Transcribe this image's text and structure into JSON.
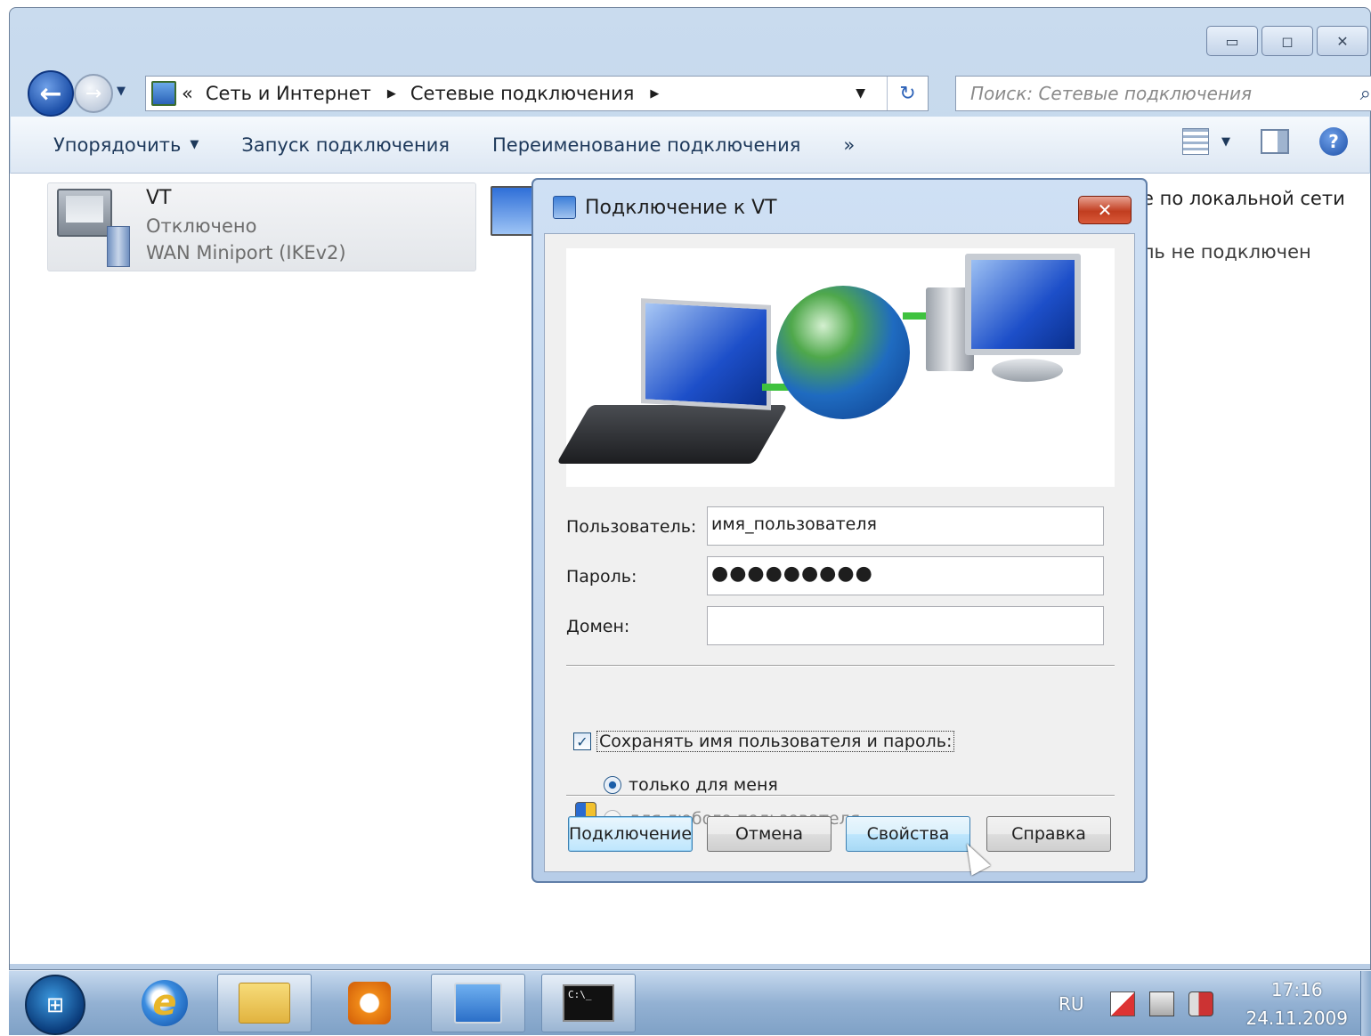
{
  "window": {
    "breadcrumb": {
      "overflow": "«",
      "items": [
        "Сеть и Интернет",
        "Сетевые подключения"
      ]
    },
    "search_placeholder": "Поиск: Сетевые подключения",
    "commands": [
      "Упорядочить",
      "Запуск подключения",
      "Переименование подключения",
      "»"
    ],
    "connection": {
      "name": "VT",
      "status": "Отключено",
      "device": "WAN Miniport (IKEv2)"
    },
    "partial_text": {
      "line1": "е по локальной сети",
      "line2": "ль не подключен"
    }
  },
  "dialog": {
    "title": "Подключение к VT",
    "close": "✕",
    "user_label": "Пользователь:",
    "user_value": "имя_пользователя",
    "password_label": "Пароль:",
    "password_value": "●●●●●●●●●",
    "domain_label": "Домен:",
    "domain_value": "",
    "save_checkbox_label": "Сохранять имя пользователя и пароль:",
    "save_checked": true,
    "radio_me": "только для меня",
    "radio_any": "для любого пользователя",
    "buttons": {
      "connect": "Подключение",
      "cancel": "Отмена",
      "properties": "Свойства",
      "help": "Справка"
    }
  },
  "taskbar": {
    "language": "RU",
    "time": "17:16",
    "date": "24.11.2009",
    "cmd_text": "C:\\_"
  },
  "icons": [
    "back-arrow-icon",
    "forward-arrow-icon",
    "network-folder-icon",
    "refresh-icon",
    "search-icon",
    "view-options-icon",
    "preview-pane-icon",
    "help-icon",
    "vpn-connection-icon",
    "windows-start-icon",
    "internet-explorer-icon",
    "explorer-folder-icon",
    "media-player-icon",
    "control-panel-icon",
    "cmd-icon",
    "action-center-icon",
    "network-tray-icon",
    "volume-muted-icon",
    "uac-shield-icon"
  ]
}
